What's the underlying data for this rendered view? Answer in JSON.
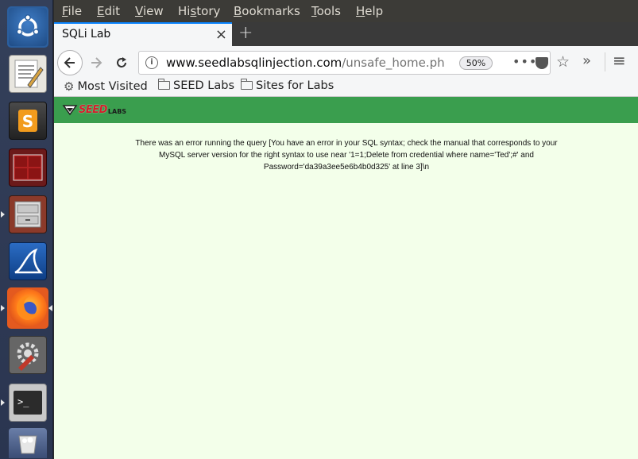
{
  "menubar": {
    "items": [
      {
        "pre": "",
        "u": "F",
        "post": "ile"
      },
      {
        "pre": "",
        "u": "E",
        "post": "dit"
      },
      {
        "pre": "",
        "u": "V",
        "post": "iew"
      },
      {
        "pre": "Hi",
        "u": "s",
        "post": "tory"
      },
      {
        "pre": "",
        "u": "B",
        "post": "ookmarks"
      },
      {
        "pre": "",
        "u": "T",
        "post": "ools"
      },
      {
        "pre": "",
        "u": "H",
        "post": "elp"
      }
    ]
  },
  "tab": {
    "title": "SQLi Lab",
    "close": "×",
    "new_tab": "+"
  },
  "navbar": {
    "url_host": "www.seedlabsqlinjection.com",
    "url_path": "/unsafe_home.php",
    "zoom": "50%",
    "dots": "•••"
  },
  "bookmarks": [
    {
      "label": "Most Visited"
    },
    {
      "label": "SEED Labs"
    },
    {
      "label": "Sites for Labs"
    }
  ],
  "page": {
    "logo_seed": "SEED",
    "logo_labs": "LABS",
    "error_text": "There was an error running the query [You have an error in your SQL syntax; check the manual that corresponds to your MySQL server version for the right syntax to use near '1=1;Delete from credential where name='Ted';#' and Password='da39a3ee5e6b4b0d325' at line 3]\\n"
  },
  "launcher": {
    "items": [
      "ubuntu-dash-icon",
      "text-editor-icon",
      "sublime-text-icon",
      "terminal-multiplexer-icon",
      "file-cabinet-icon",
      "wireshark-icon",
      "firefox-icon",
      "system-settings-icon",
      "terminal-icon",
      "trash-icon"
    ]
  }
}
